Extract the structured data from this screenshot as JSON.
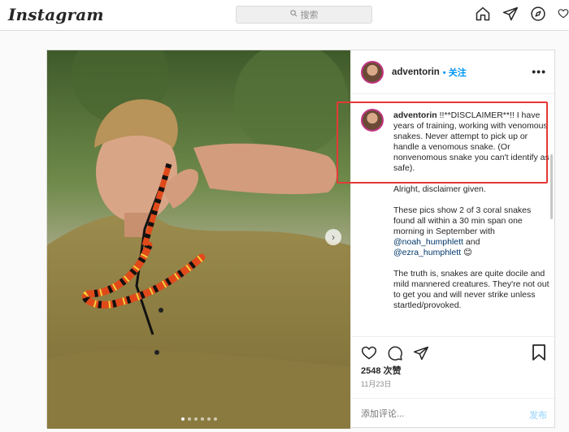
{
  "header": {
    "logo": "Instagram",
    "search_placeholder": "搜索",
    "nav_icons": [
      "home-icon",
      "direct-icon",
      "explore-icon",
      "heart-icon"
    ]
  },
  "post": {
    "username": "adventorin",
    "follow_label": "• 关注",
    "more_label": "•••",
    "caption": {
      "username": "adventorin",
      "lines": [
        "!!**DISCLAIMER**!! I have years of training, working with venomous snakes. Never attempt to pick up or handle a venomous snake. (Or nonvenomous snake you can't identify as safe).",
        "Alright, disclaimer given.",
        "These pics show 2 of 3 coral snakes found all within a 30 min span one morning in September with",
        "and",
        "The truth is, snakes are quite docile and mild mannered creatures. They're not out to get you and will never strike unless startled/provoked."
      ],
      "mention1": "@noah_humphlett",
      "mention2": "@ezra_humphlett",
      "emoji": "😊"
    },
    "likes": "2548 次赞",
    "date": "11月23日",
    "comment_placeholder": "添加评论...",
    "post_button": "发布",
    "carousel": {
      "count": 6,
      "active_index": 0
    },
    "next_arrow": "›"
  }
}
